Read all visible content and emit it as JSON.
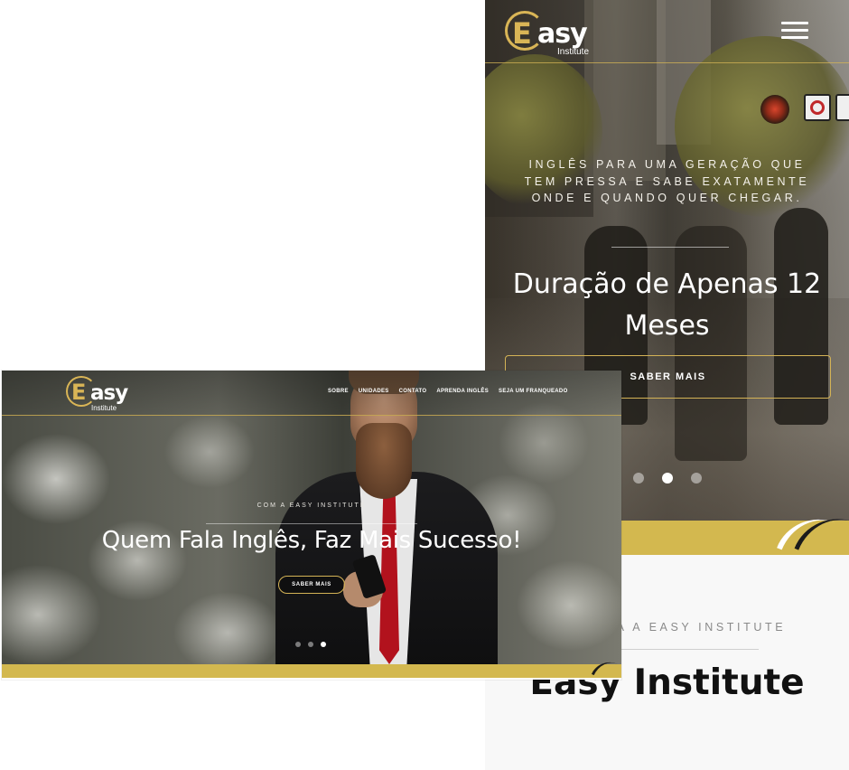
{
  "brand": {
    "logo_word": "asy",
    "logo_letter": "E",
    "logo_sub": "Institute",
    "accent_color": "#d3b84f"
  },
  "mobile": {
    "hero": {
      "tagline": "INGLÊS PARA UMA GERAÇÃO QUE TEM PRESSA E SABE EXATAMENTE ONDE E QUANDO QUER CHEGAR.",
      "title": "Duração de Apenas 12 Meses",
      "button_label": "SABER MAIS",
      "slides": [
        {
          "active": false
        },
        {
          "active": true
        },
        {
          "active": false
        }
      ]
    },
    "menu_icon": "hamburger-icon",
    "about": {
      "label": "CONHEÇA A EASY INSTITUTE",
      "title": "Easy Institute"
    }
  },
  "desktop": {
    "nav": {
      "items": [
        "SOBRE",
        "UNIDADES",
        "CONTATO",
        "APRENDA INGLÊS",
        "SEJA UM FRANQUEADO"
      ]
    },
    "hero": {
      "kicker": "COM A EASY INSTITUTE",
      "title": "Quem Fala Inglês, Faz Mais Sucesso!",
      "button_label": "SABER MAIS",
      "slides": [
        {
          "active": false
        },
        {
          "active": false
        },
        {
          "active": true
        }
      ]
    }
  }
}
